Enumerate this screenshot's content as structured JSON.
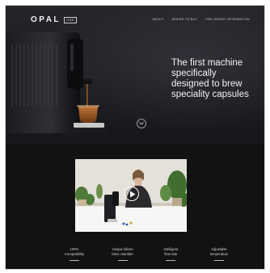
{
  "brand": {
    "logo_text": "OPAL",
    "logo_badge": "ONE"
  },
  "nav": {
    "links": [
      {
        "label": "ABOUT"
      },
      {
        "label": "WHERE TO BUY"
      },
      {
        "label": "PRE-ORDER INFORMATION"
      }
    ]
  },
  "hero": {
    "title_lines": [
      "The first machine",
      "specifically",
      "designed to brew",
      "speciality capsules"
    ],
    "scroll_icon": "chevron-down-icon"
  },
  "video": {
    "play_icon": "play-icon"
  },
  "features": [
    {
      "label": "100%\nCompatibility"
    },
    {
      "label": "Unique silicon\nbrew chamber"
    },
    {
      "label": "Intelligent\nflow rate"
    },
    {
      "label": "Adjustable\ntemperature"
    }
  ],
  "colors": {
    "background": "#121212",
    "hero_top": "#24252a",
    "text": "#f4f4f4",
    "coffee": "#8a4a1c"
  }
}
